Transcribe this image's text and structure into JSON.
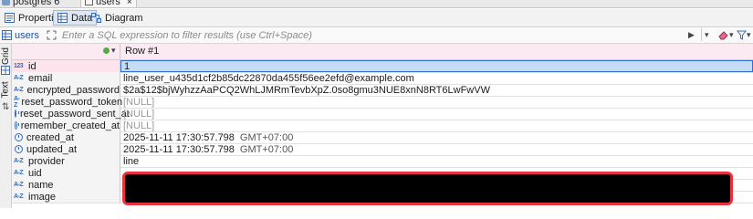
{
  "editor_tabs": [
    {
      "label": "postgres 6"
    },
    {
      "label": "users",
      "close": "×"
    }
  ],
  "subtabs": [
    {
      "label": "Properties",
      "icon": "properties-icon"
    },
    {
      "label": "Data",
      "icon": "table-icon",
      "active": true
    },
    {
      "label": "Diagram",
      "icon": "diagram-icon"
    }
  ],
  "filter": {
    "table": "users",
    "placeholder": "Enter a SQL expression to filter results (use Ctrl+Space)"
  },
  "side_tabs": [
    "Grid",
    "Text"
  ],
  "grid": {
    "header": "Row  #1",
    "rows": [
      {
        "name": "id",
        "type": "123",
        "value": "1",
        "selected": true
      },
      {
        "name": "email",
        "type": "A-Z",
        "value": "line_user_u435d1cf2b85dc22870da455f56ee2efd@example.com"
      },
      {
        "name": "encrypted_password",
        "type": "A-Z",
        "value": "$2a$12$bjWyhzzAaPCQ2WhLJMRmTevbXpZ.0so8gmu3NUE8xnN8RT6LwFwVW"
      },
      {
        "name": "reset_password_token",
        "type": "A-Z",
        "value": "[NULL]",
        "null": true
      },
      {
        "name": "reset_password_sent_at",
        "type": "clock",
        "value": "[NULL]",
        "null": true
      },
      {
        "name": "remember_created_at",
        "type": "clock",
        "value": "[NULL]",
        "null": true
      },
      {
        "name": "created_at",
        "type": "clock",
        "value": "2025-11-11 17:30:57.798",
        "tz": "GMT+07:00"
      },
      {
        "name": "updated_at",
        "type": "clock",
        "value": "2025-11-11 17:30:57.798",
        "tz": "GMT+07:00"
      },
      {
        "name": "provider",
        "type": "A-Z",
        "value": "line"
      },
      {
        "name": "uid",
        "type": "A-Z",
        "value": ""
      },
      {
        "name": "name",
        "type": "A-Z",
        "value": ""
      },
      {
        "name": "image",
        "type": "A-Z",
        "value": ""
      }
    ]
  },
  "colors": {
    "redaction_border": "#e8323c",
    "selection": "#c6dcf6",
    "link_blue": "#1f4fa3"
  }
}
